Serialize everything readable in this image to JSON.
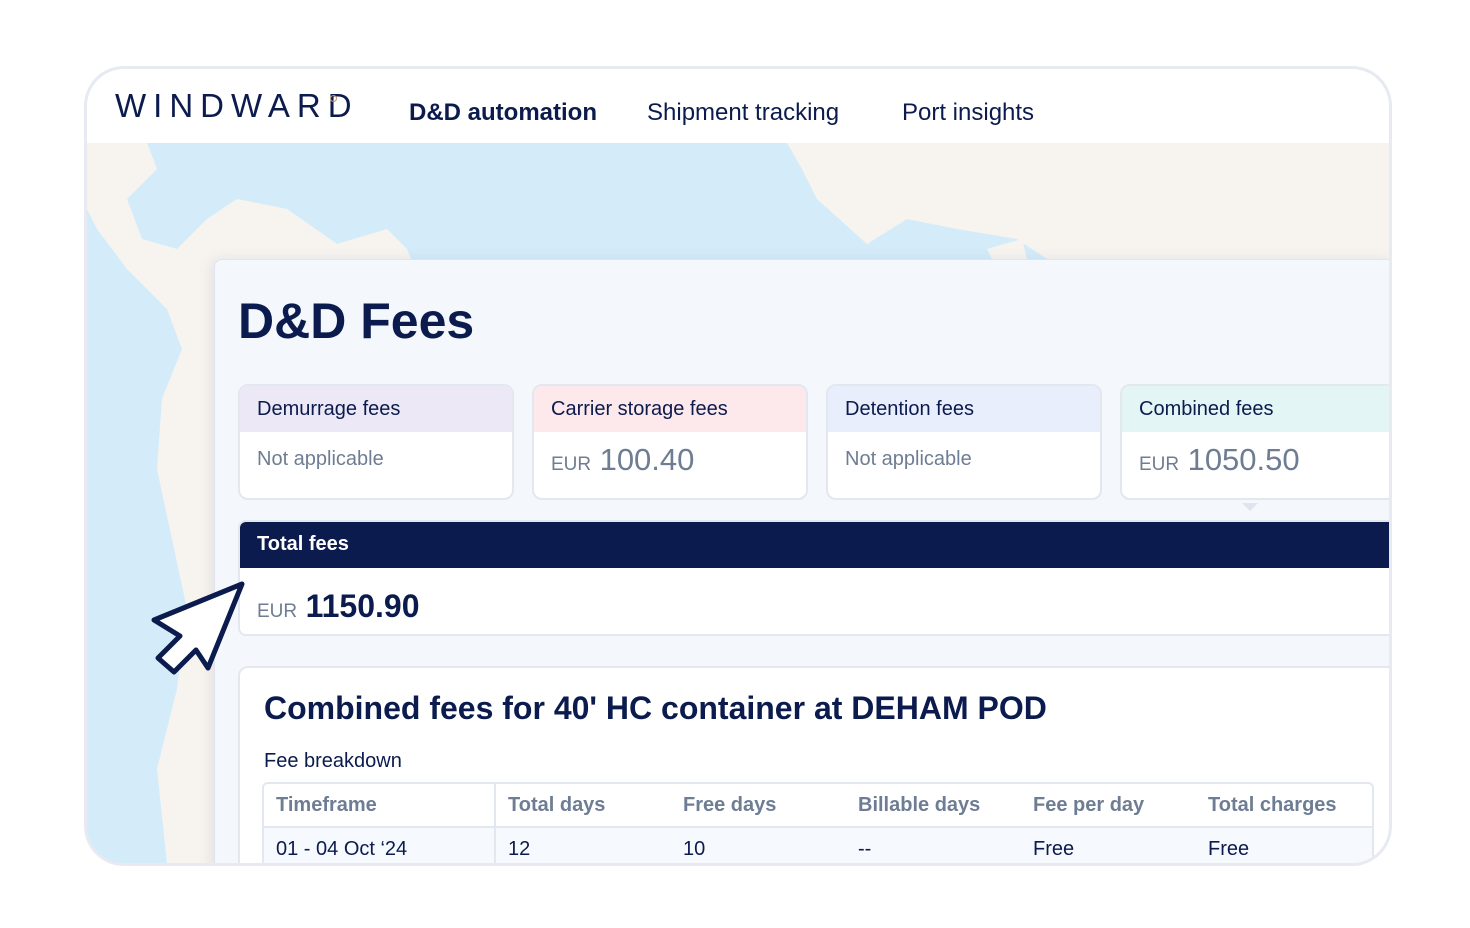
{
  "header": {
    "logo": "WINDWARD",
    "nav": [
      {
        "label": "D&D automation",
        "active": true
      },
      {
        "label": "Shipment tracking",
        "active": false
      },
      {
        "label": "Port insights",
        "active": false
      }
    ]
  },
  "page": {
    "title": "D&D Fees"
  },
  "fee_cards": [
    {
      "label": "Demurrage fees",
      "value": "Not applicable",
      "currency": "",
      "header_color": "#ece8f6"
    },
    {
      "label": "Carrier storage fees",
      "value": "100.40",
      "currency": "EUR",
      "header_color": "#fde8ec"
    },
    {
      "label": "Detention fees",
      "value": "Not applicable",
      "currency": "",
      "header_color": "#e8eefc"
    },
    {
      "label": "Combined fees",
      "value": "1050.50",
      "currency": "EUR",
      "header_color": "#e3f5f5"
    }
  ],
  "total": {
    "label": "Total fees",
    "currency": "EUR",
    "value": "1150.90"
  },
  "breakdown": {
    "title": "Combined fees for 40' HC container at DEHAM POD",
    "subtitle": "Fee breakdown",
    "columns": [
      "Timeframe",
      "Total days",
      "Free days",
      "Billable days",
      "Fee per day",
      "Total charges"
    ],
    "rows": [
      [
        "01 - 04 Oct ‘24",
        "12",
        "10",
        "--",
        "Free",
        "Free"
      ]
    ]
  },
  "colors": {
    "navy": "#0b1b4d",
    "muted": "#6e7d93",
    "sea": "#d4ecfa",
    "land": "#f7f4f0",
    "logo_accent": "#c8925a"
  }
}
